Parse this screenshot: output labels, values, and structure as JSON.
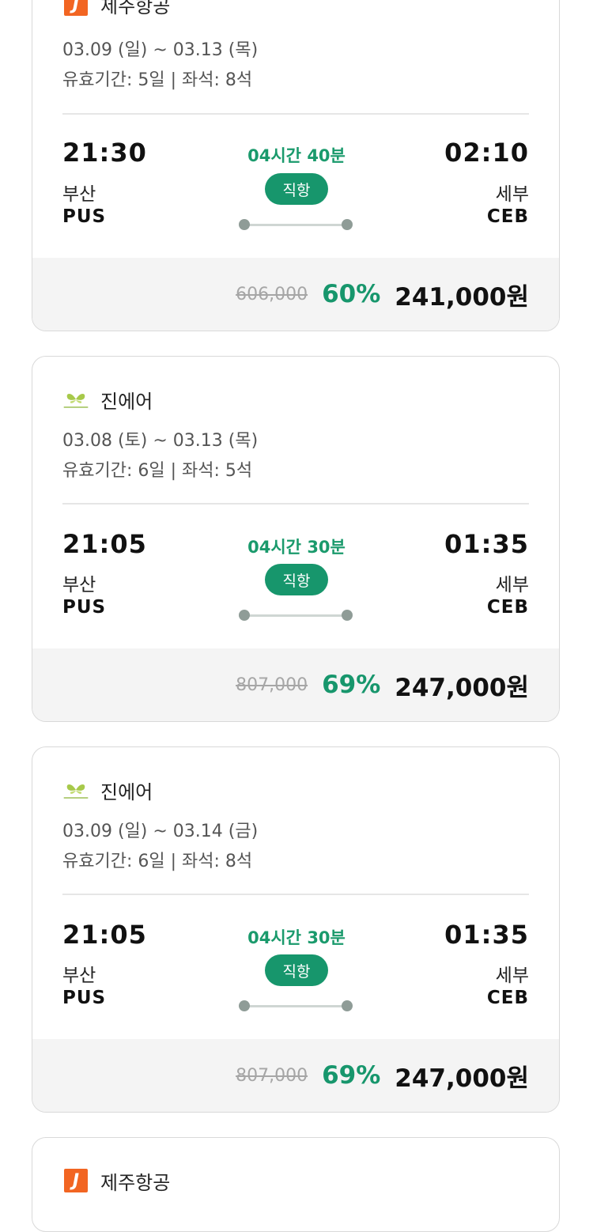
{
  "cards": [
    {
      "airline": "제주항공",
      "logo": "jejuair-logo",
      "dates": "03.09 (일) ~ 03.13 (목)",
      "validity": "유효기간: 5일 | 좌석: 8석",
      "depart_time": "21:30",
      "depart_city": "부산",
      "depart_code": "PUS",
      "duration": "04시간 40분",
      "direct_label": "직항",
      "arrive_time": "02:10",
      "arrive_city": "세부",
      "arrive_code": "CEB",
      "original_price": "606,000",
      "discount": "60%",
      "price": "241,000원"
    },
    {
      "airline": "진에어",
      "logo": "jinair-logo",
      "dates": "03.08 (토) ~ 03.13 (목)",
      "validity": "유효기간: 6일 | 좌석: 5석",
      "depart_time": "21:05",
      "depart_city": "부산",
      "depart_code": "PUS",
      "duration": "04시간 30분",
      "direct_label": "직항",
      "arrive_time": "01:35",
      "arrive_city": "세부",
      "arrive_code": "CEB",
      "original_price": "807,000",
      "discount": "69%",
      "price": "247,000원"
    },
    {
      "airline": "진에어",
      "logo": "jinair-logo",
      "dates": "03.09 (일) ~ 03.14 (금)",
      "validity": "유효기간: 6일 | 좌석: 8석",
      "depart_time": "21:05",
      "depart_city": "부산",
      "depart_code": "PUS",
      "duration": "04시간 30분",
      "direct_label": "직항",
      "arrive_time": "01:35",
      "arrive_city": "세부",
      "arrive_code": "CEB",
      "original_price": "807,000",
      "discount": "69%",
      "price": "247,000원"
    },
    {
      "airline": "제주항공",
      "logo": "jejuair-logo"
    }
  ],
  "colors": {
    "accent_green": "#17966c",
    "jeju_orange": "#f26522",
    "jinair_lime": "#a7c94a"
  }
}
